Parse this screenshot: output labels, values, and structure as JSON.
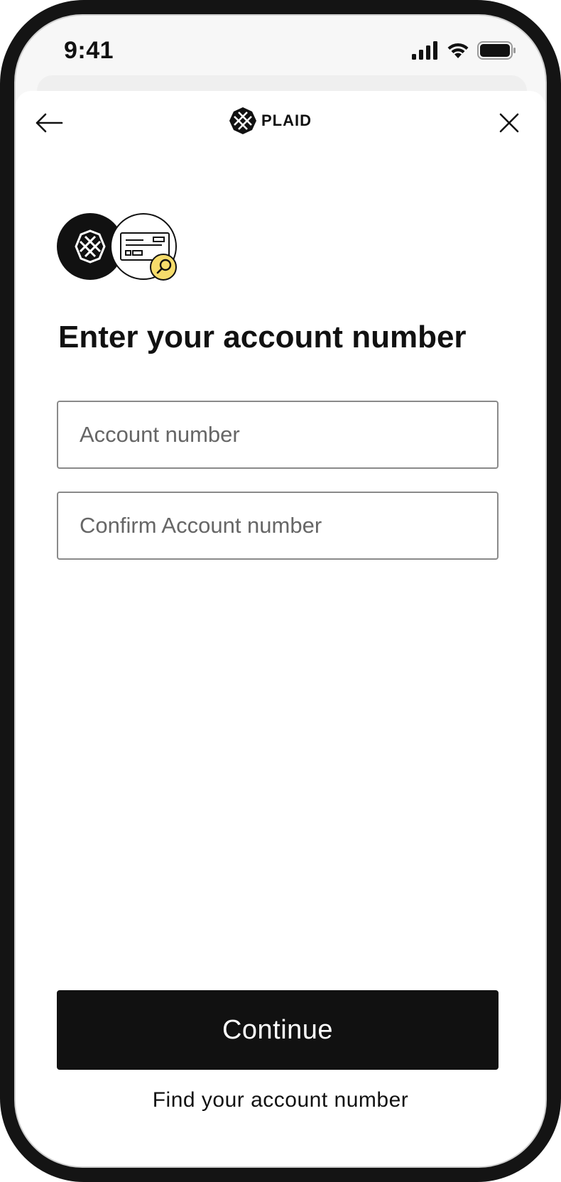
{
  "status_bar": {
    "time": "9:41",
    "icons": [
      "cellular-signal-icon",
      "wifi-icon",
      "battery-icon"
    ]
  },
  "nav": {
    "back_icon": "arrow-left-icon",
    "close_icon": "close-icon",
    "brand_name": "PLAID",
    "brand_icon": "plaid-logo-icon"
  },
  "hero": {
    "icons": [
      "plaid-logo-icon",
      "check-document-icon",
      "magnifier-icon"
    ],
    "accent_color": "#f6dc6b"
  },
  "page": {
    "title": "Enter your account number"
  },
  "form": {
    "account_number": {
      "value": "",
      "placeholder": "Account number"
    },
    "confirm_account_number": {
      "value": "",
      "placeholder": "Confirm Account number"
    }
  },
  "actions": {
    "continue_label": "Continue",
    "find_link_label": "Find your account number"
  },
  "colors": {
    "primary": "#111111",
    "background": "#ffffff",
    "field_border": "#8a8a8a",
    "placeholder": "#666666"
  }
}
